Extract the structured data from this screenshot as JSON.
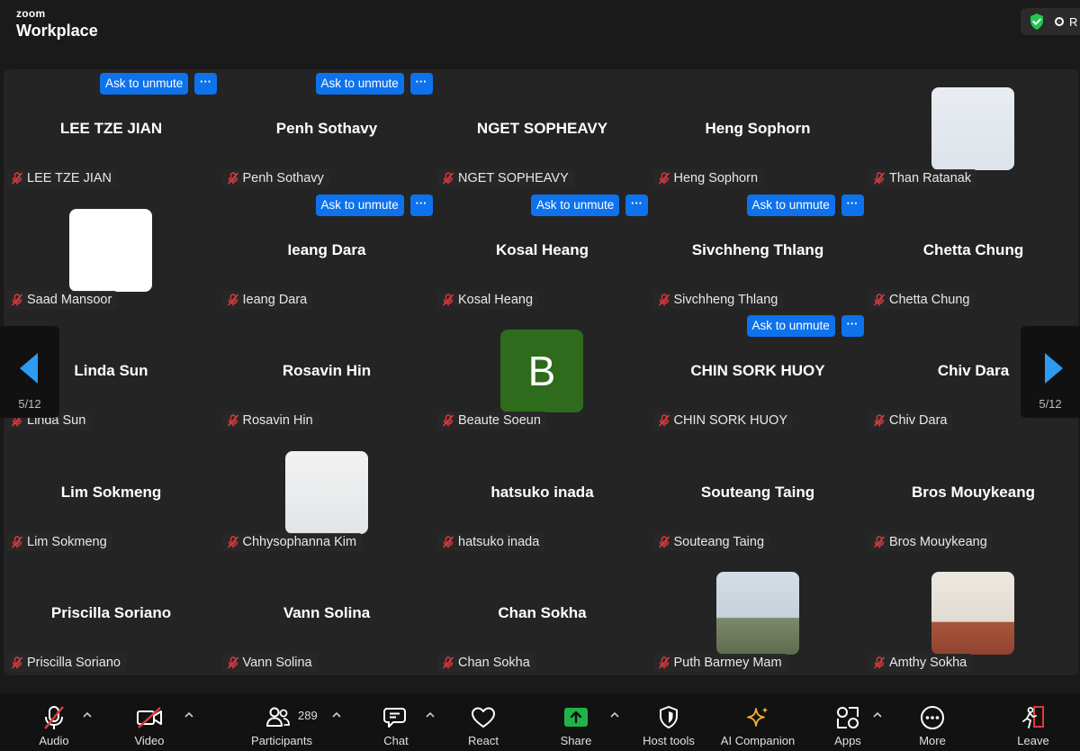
{
  "app": {
    "brand_small": "zoom",
    "brand_large": "Workplace",
    "recording_label": "R"
  },
  "controls": {
    "ask_to_unmute": "Ask to unmute",
    "more": "···"
  },
  "pager": {
    "left_page": "5/12",
    "right_page": "5/12"
  },
  "participants": [
    {
      "center": "LEE TZE JIAN",
      "label": "LEE TZE JIAN",
      "ask": true
    },
    {
      "center": "Penh Sothavy",
      "label": "Penh Sothavy",
      "ask": true
    },
    {
      "center": "NGET SOPHEAVY",
      "label": "NGET SOPHEAVY",
      "ask": false
    },
    {
      "center": "Heng Sophorn",
      "label": "Heng Sophorn",
      "ask": false
    },
    {
      "center": "",
      "label": "Than Ratanak",
      "ask": false,
      "photo": "p1"
    },
    {
      "center": "",
      "label": "Saad Mansoor",
      "ask": false,
      "photo": "white"
    },
    {
      "center": "Ieang Dara",
      "label": "Ieang Dara",
      "ask": true
    },
    {
      "center": "Kosal Heang",
      "label": "Kosal Heang",
      "ask": true
    },
    {
      "center": "Sivchheng Thlang",
      "label": "Sivchheng Thlang",
      "ask": true
    },
    {
      "center": "Chetta Chung",
      "label": "Chetta Chung",
      "ask": false
    },
    {
      "center": "Linda Sun",
      "label": "Linda Sun",
      "ask": false
    },
    {
      "center": "Rosavin Hin",
      "label": "Rosavin Hin",
      "ask": false
    },
    {
      "center": "",
      "label": "Beaute Soeun",
      "ask": false,
      "photo": "avatar-b",
      "avatar_letter": "B"
    },
    {
      "center": "CHIN SORK HUOY",
      "label": "CHIN SORK HUOY",
      "ask": true
    },
    {
      "center": "Chiv Dara",
      "label": "Chiv Dara",
      "ask": false
    },
    {
      "center": "Lim Sokmeng",
      "label": "Lim Sokmeng",
      "ask": false
    },
    {
      "center": "",
      "label": "Chhysophanna Kim",
      "ask": false,
      "photo": "p2"
    },
    {
      "center": "hatsuko inada",
      "label": "hatsuko inada",
      "ask": false
    },
    {
      "center": "Souteang Taing",
      "label": "Souteang Taing",
      "ask": false
    },
    {
      "center": "Bros Mouykeang",
      "label": "Bros Mouykeang",
      "ask": false
    },
    {
      "center": "Priscilla Soriano",
      "label": "Priscilla Soriano",
      "ask": false
    },
    {
      "center": "Vann Solina",
      "label": "Vann Solina",
      "ask": false
    },
    {
      "center": "Chan Sokha",
      "label": "Chan Sokha",
      "ask": false
    },
    {
      "center": "",
      "label": "Puth Barmey Mam",
      "ask": false,
      "photo": "p3"
    },
    {
      "center": "",
      "label": "Amthy Sokha",
      "ask": false,
      "photo": "p4"
    }
  ],
  "toolbar": {
    "audio": "Audio",
    "video": "Video",
    "participants": "Participants",
    "participants_count": "289",
    "chat": "Chat",
    "react": "React",
    "share": "Share",
    "host_tools": "Host tools",
    "ai_companion": "AI Companion",
    "apps": "Apps",
    "more": "More",
    "leave": "Leave"
  },
  "colors": {
    "accent_blue": "#0e72ed",
    "share_green": "#21b34a",
    "muted_red": "#e0393e",
    "ai_gold": "#f2b233",
    "leave_red": "#e0393e"
  }
}
